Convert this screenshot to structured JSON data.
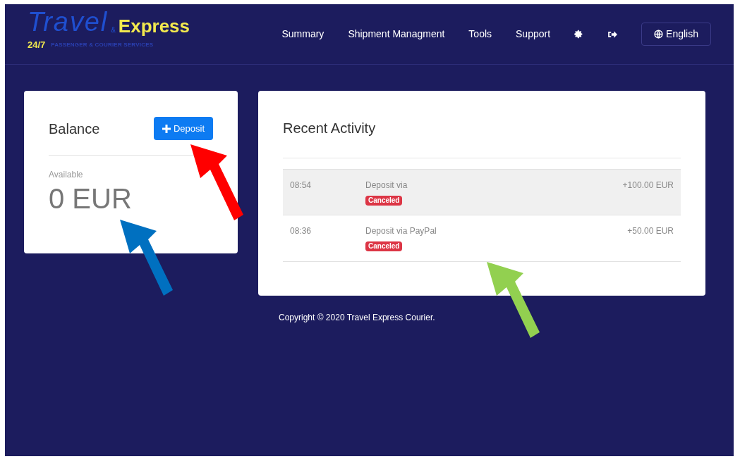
{
  "logo": {
    "word_1": "Travel",
    "ampersand": "&",
    "word_2": "Express",
    "hours": "24/7",
    "tagline": "PASSENGER & COURIER SERVICES"
  },
  "nav": [
    {
      "label": "Summary"
    },
    {
      "label": "Shipment Managment"
    },
    {
      "label": "Tools"
    },
    {
      "label": "Support"
    }
  ],
  "language_button": "English",
  "balance": {
    "title": "Balance",
    "deposit_button": "Deposit",
    "available_label": "Available",
    "amount": "0 EUR"
  },
  "recent_activity": {
    "title": "Recent Activity",
    "rows": [
      {
        "time": "08:54",
        "description": "Deposit via",
        "status": "Canceled",
        "amount": "+100.00 EUR",
        "highlighted": true
      },
      {
        "time": "08:36",
        "description": "Deposit via PayPal",
        "status": "Canceled",
        "amount": "+50.00 EUR",
        "highlighted": false
      }
    ]
  },
  "footer": "Copyright © 2020 Travel Express Courier.",
  "annotations": [
    {
      "color": "#ff0000"
    },
    {
      "color": "#0070c0"
    },
    {
      "color": "#92d050"
    }
  ]
}
